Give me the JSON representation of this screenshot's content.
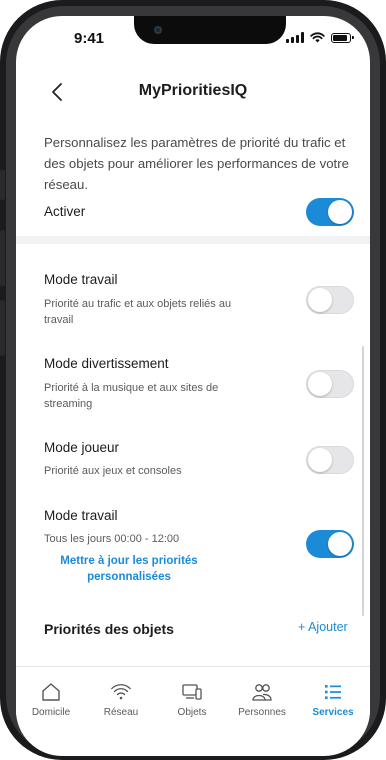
{
  "status_bar": {
    "time": "9:41"
  },
  "header": {
    "title": "MyPrioritiesIQ"
  },
  "intro": {
    "text": "Personnalisez les paramètres de priorité du trafic et des objets pour améliorer les performances de votre réseau."
  },
  "activate": {
    "label": "Activer",
    "enabled": true
  },
  "modes": [
    {
      "title": "Mode travail",
      "description": "Priorité au trafic et aux objets reliés au travail",
      "enabled": false
    },
    {
      "title": "Mode divertissement",
      "description": "Priorité à la musique et aux sites de streaming",
      "enabled": false
    },
    {
      "title": "Mode joueur",
      "description": "Priorité aux jeux et consoles",
      "enabled": false
    },
    {
      "title": "Mode travail",
      "description": "Tous les jours 00:00 - 12:00",
      "enabled": true,
      "link": "Mettre à jour les priorités personnalisées"
    }
  ],
  "objects_section": {
    "title": "Priorités des objets",
    "add_label": "+ Ajouter"
  },
  "tabbar": {
    "active": "Services",
    "accent_color": "#1b8bd8",
    "items": [
      {
        "label": "Domicile",
        "icon": "home-icon"
      },
      {
        "label": "Réseau",
        "icon": "wifi-icon"
      },
      {
        "label": "Objets",
        "icon": "devices-icon"
      },
      {
        "label": "Personnes",
        "icon": "people-icon"
      },
      {
        "label": "Services",
        "icon": "list-icon"
      }
    ]
  }
}
